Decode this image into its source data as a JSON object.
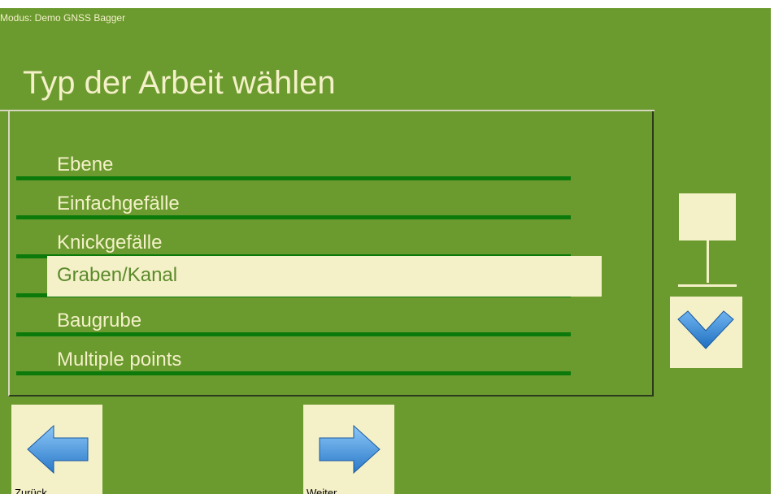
{
  "header": {
    "mode_text": "Modus: Demo GNSS Bagger",
    "title": "Typ der Arbeit wählen"
  },
  "work_types": {
    "items": [
      {
        "label": "Ebene",
        "selected": false
      },
      {
        "label": "Einfachgefälle",
        "selected": false
      },
      {
        "label": "Knickgefälle",
        "selected": false
      },
      {
        "label": "Graben/Kanal",
        "selected": true
      },
      {
        "label": "Baugrube",
        "selected": false
      },
      {
        "label": "Multiple points",
        "selected": false
      }
    ]
  },
  "scrollbar": {
    "down_icon": "chevron-down-icon"
  },
  "footer": {
    "back_label": "Zurück",
    "back_icon": "arrow-left-icon",
    "next_label": "Weiter",
    "next_icon": "arrow-right-icon"
  },
  "colors": {
    "background": "#6b9a2f",
    "text_light": "#f4f0c8",
    "divider": "#0b7a0b",
    "selection": "#f4f0c8",
    "icon_blue": "#3b8fd8"
  }
}
